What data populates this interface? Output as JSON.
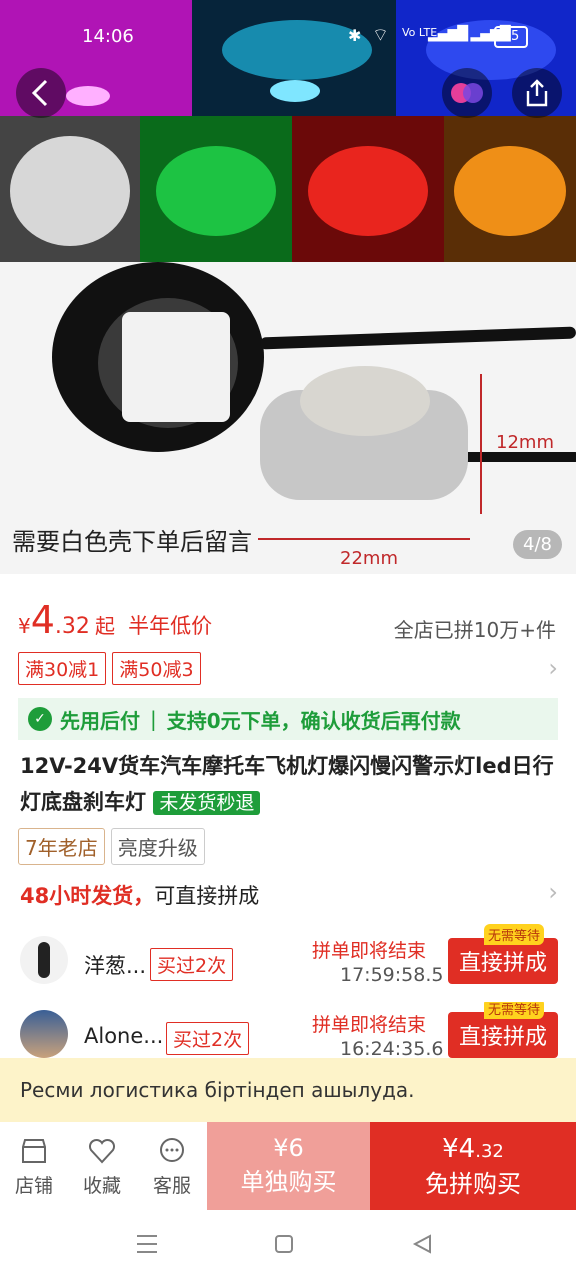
{
  "status_bar": {
    "time": "14:06",
    "battery": "65",
    "network": "Vo LTE"
  },
  "hero": {
    "overlay_text": "需要白色壳下单后留言",
    "dim_height": "12mm",
    "dim_width": "22mm",
    "page_indicator": "4/8"
  },
  "price": {
    "currency": "¥",
    "integer": "4",
    "decimal": ".32",
    "suffix": "起",
    "label": "半年低价",
    "sold": "全店已拼10万+件"
  },
  "coupons": [
    "满30减1",
    "满50减3"
  ],
  "pay_later": {
    "title": "先用后付",
    "desc": "支持0元下单，确认收货后再付款"
  },
  "product": {
    "title": "12V-24V货车汽车摩托车飞机灯爆闪慢闪警示灯led日行灯底盘刹车灯",
    "badge": "未发货秒退"
  },
  "tags": [
    "7年老店",
    "亮度升级"
  ],
  "shipping": {
    "highlight": "48小时发货，",
    "text": "可直接拼成"
  },
  "groups": [
    {
      "name": "洋葱...",
      "bought": "买过2次",
      "status": "拼单即将结束",
      "time": "17:59:58.5",
      "no_wait": "无需等待",
      "button": "直接拼成"
    },
    {
      "name": "Alone...",
      "bought": "买过2次",
      "status": "拼单即将结束",
      "time": "16:24:35.6",
      "no_wait": "无需等待",
      "button": "直接拼成"
    }
  ],
  "toast": "Ресми логистика біртіндеп  ашылуда.",
  "bottom_bar": {
    "shop": "店铺",
    "favorite": "收藏",
    "service": "客服",
    "alone_price": "¥6",
    "alone_label": "单独购买",
    "group_price_int": "¥4",
    "group_price_dec": ".32",
    "group_label": "免拼购买"
  },
  "colors": {
    "accent": "#e02e24",
    "green": "#1e9d3a",
    "toast_bg": "#fdf3c9"
  }
}
